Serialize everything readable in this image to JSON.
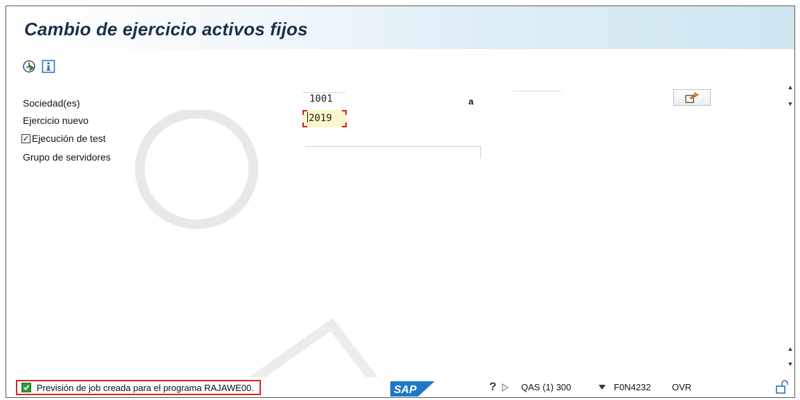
{
  "window": {
    "title": "Cambio de ejercicio activos fijos"
  },
  "toolbar": {
    "execute_icon": "execute-clock-icon",
    "info_icon": "info-icon"
  },
  "form": {
    "sociedad_label": "Sociedad(es)",
    "sociedad_value": "1001",
    "range_to_label": "a",
    "sociedad_to_value": "",
    "ejercicio_label": "Ejercicio nuevo",
    "ejercicio_value": "2019",
    "test_run_label": "Ejecución de test",
    "test_run_checked": true,
    "grupo_label": "Grupo de servidores",
    "grupo_value": "",
    "multiselect_icon": "multiple-selection-arrow-icon"
  },
  "status": {
    "message": "Previsión de job creada para el programa RAJAWE00.",
    "type_icon": "success-check-icon",
    "logo_text": "SAP",
    "system": "QAS (1) 300",
    "server": "F0N4232",
    "mode": "OVR"
  },
  "colors": {
    "title": "#1b2f4a",
    "required_field_bg": "#fbf6c9",
    "highlight_border": "#d7261e",
    "success": "#2f9c3a",
    "sap_blue": "#1d78c4"
  }
}
